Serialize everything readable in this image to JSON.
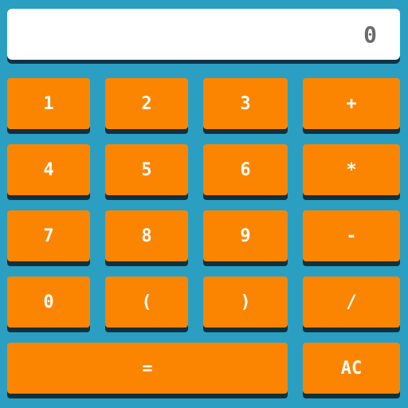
{
  "display": {
    "value": "0"
  },
  "keys": {
    "one": "1",
    "two": "2",
    "three": "3",
    "plus": "+",
    "four": "4",
    "five": "5",
    "six": "6",
    "multiply": "*",
    "seven": "7",
    "eight": "8",
    "nine": "9",
    "minus": "-",
    "zero": "0",
    "open_paren": "(",
    "close_paren": ")",
    "divide": "/",
    "equals": "=",
    "clear": "AC"
  },
  "colors": {
    "background": "#2a9fc2",
    "key": "#fb8500",
    "key_shadow": "#11313d",
    "display_bg": "#ffffff",
    "display_text": "#6b6b6b"
  }
}
